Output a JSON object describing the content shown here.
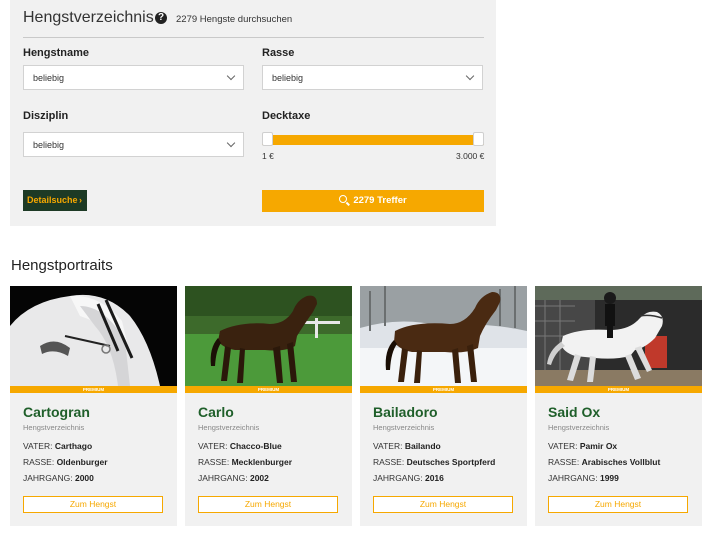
{
  "search": {
    "title": "Hengstverzeichnis",
    "subtitle": "2279 Hengste durchsuchen",
    "fields": {
      "name": {
        "label": "Hengstname",
        "value": "beliebig"
      },
      "rasse": {
        "label": "Rasse",
        "value": "beliebig"
      },
      "disziplin": {
        "label": "Disziplin",
        "value": "beliebig"
      },
      "decktaxe": {
        "label": "Decktaxe",
        "min_label": "1 €",
        "max_label": "3.000 €",
        "min_value": 1,
        "max_value": 3000
      }
    },
    "detail_button": "Detailsuche",
    "detail_arrow": "›",
    "results_button": "2279 Treffer"
  },
  "portraits": {
    "heading": "Hengstportraits",
    "premium_label": "PREMIUM",
    "cards": [
      {
        "name": "Cartogran",
        "sub": "Hengstverzeichnis",
        "vater_label": "VATER:",
        "vater": "Carthago",
        "rasse_label": "RASSE:",
        "rasse": "Oldenburger",
        "jahrgang_label": "JAHRGANG:",
        "jahrgang": "2000",
        "button": "Zum Hengst"
      },
      {
        "name": "Carlo",
        "sub": "Hengstverzeichnis",
        "vater_label": "VATER:",
        "vater": "Chacco-Blue",
        "rasse_label": "RASSE:",
        "rasse": "Mecklenburger",
        "jahrgang_label": "JAHRGANG:",
        "jahrgang": "2002",
        "button": "Zum Hengst"
      },
      {
        "name": "Bailadoro",
        "sub": "Hengstverzeichnis",
        "vater_label": "VATER:",
        "vater": "Bailando",
        "rasse_label": "RASSE:",
        "rasse": "Deutsches Sportpferd",
        "jahrgang_label": "JAHRGANG:",
        "jahrgang": "2016",
        "button": "Zum Hengst"
      },
      {
        "name": "Said Ox",
        "sub": "Hengstverzeichnis",
        "vater_label": "VATER:",
        "vater": "Pamir Ox",
        "rasse_label": "RASSE:",
        "rasse": "Arabisches Vollblut",
        "jahrgang_label": "JAHRGANG:",
        "jahrgang": "1999",
        "button": "Zum Hengst"
      }
    ]
  },
  "colors": {
    "accent": "#f6a800",
    "dark_green": "#1d3a25",
    "name_green": "#1f5f2a",
    "panel": "#f1f1f1"
  }
}
